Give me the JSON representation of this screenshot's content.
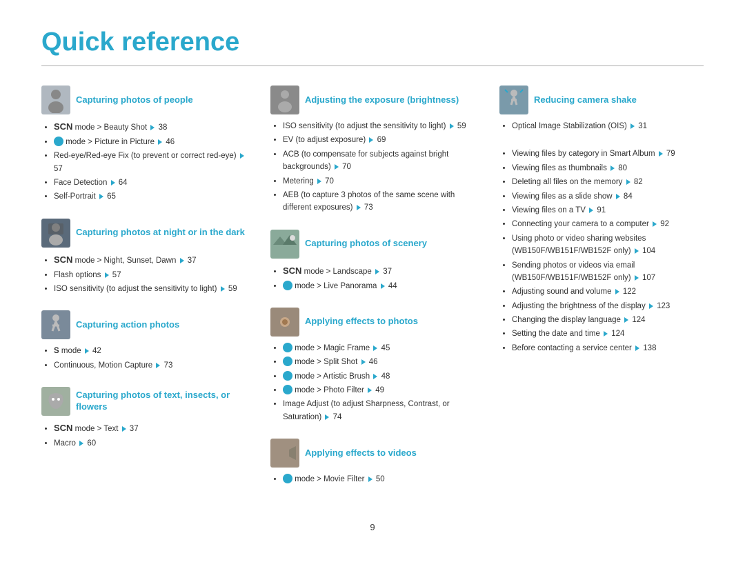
{
  "page": {
    "title": "Quick reference",
    "page_number": "9"
  },
  "columns": [
    {
      "sections": [
        {
          "id": "people",
          "title": "Capturing photos of people",
          "icon": "person-icon",
          "items": [
            "<span class='scn'>SCN</span> mode > Beauty Shot <span class='arrow'></span> 38",
            "<span class='star-icon'></span> mode > Picture in Picture <span class='arrow'></span> 46",
            "Red-eye/Red-eye Fix (to prevent or correct red-eye) <span class='arrow'></span> 57",
            "Face Detection <span class='arrow'></span> 64",
            "Self-Portrait <span class='arrow'></span> 65"
          ]
        },
        {
          "id": "night",
          "title": "Capturing photos at night or in the dark",
          "icon": "night-icon",
          "items": [
            "<span class='scn'>SCN</span> mode > Night, Sunset, Dawn <span class='arrow'></span> 37",
            "Flash options <span class='arrow'></span> 57",
            "ISO sensitivity (to adjust the sensitivity to light) <span class='arrow'></span> 59"
          ]
        },
        {
          "id": "action",
          "title": "Capturing action photos",
          "icon": "action-icon",
          "items": [
            "<b>S</b> mode <span class='arrow'></span> 42",
            "Continuous, Motion Capture <span class='arrow'></span> 73"
          ]
        },
        {
          "id": "text",
          "title": "Capturing photos of text, insects, or flowers",
          "icon": "text-icon",
          "items": [
            "<span class='scn'>SCN</span> mode > Text <span class='arrow'></span> 37",
            "Macro <span class='arrow'></span> 60"
          ]
        }
      ]
    },
    {
      "sections": [
        {
          "id": "exposure",
          "title": "Adjusting the exposure (brightness)",
          "icon": "exposure-icon",
          "items": [
            "ISO sensitivity (to adjust the sensitivity to light) <span class='arrow'></span> 59",
            "EV (to adjust exposure) <span class='arrow'></span> 69",
            "ACB (to compensate for subjects against bright backgrounds) <span class='arrow'></span> 70",
            "Metering <span class='arrow'></span> 70",
            "AEB (to capture 3 photos of the same scene with different exposures) <span class='arrow'></span> 73"
          ]
        },
        {
          "id": "scenery",
          "title": "Capturing photos of scenery",
          "icon": "scenery-icon",
          "items": [
            "<span class='scn'>SCN</span> mode > Landscape <span class='arrow'></span> 37",
            "<span class='star-icon'></span> mode > Live Panorama <span class='arrow'></span> 44"
          ]
        },
        {
          "id": "effects-photos",
          "title": "Applying effects to photos",
          "icon": "effects-photo-icon",
          "items": [
            "<span class='star-icon'></span> mode > Magic Frame <span class='arrow'></span> 45",
            "<span class='star-icon'></span> mode > Split Shot <span class='arrow'></span> 46",
            "<span class='star-icon'></span> mode > Artistic Brush <span class='arrow'></span> 48",
            "<span class='star-icon'></span> mode > Photo Filter <span class='arrow'></span> 49",
            "Image Adjust (to adjust Sharpness, Contrast, or Saturation) <span class='arrow'></span> 74"
          ]
        },
        {
          "id": "effects-videos",
          "title": "Applying effects to videos",
          "icon": "effects-video-icon",
          "items": [
            "<span class='star-icon'></span> mode > Movie Filter <span class='arrow'></span> 50"
          ]
        }
      ]
    },
    {
      "sections": [
        {
          "id": "shake",
          "title": "Reducing camera shake",
          "icon": "shake-icon",
          "items": [
            "Optical Image Stabilization (OIS) <span class='arrow'></span> 31"
          ]
        },
        {
          "id": "viewing",
          "title": "",
          "icon": null,
          "items": [
            "Viewing files by category in Smart Album <span class='arrow'></span> 79",
            "Viewing files as thumbnails <span class='arrow'></span> 80",
            "Deleting all files on the memory <span class='arrow'></span> 82",
            "Viewing files as a slide show <span class='arrow'></span> 84",
            "Viewing files on a TV <span class='arrow'></span> 91",
            "Connecting your camera to a computer <span class='arrow'></span> 92",
            "Using photo or video sharing websites (WB150F/WB151F/WB152F only) <span class='arrow'></span> 104",
            "Sending photos or videos via email (WB150F/WB151F/WB152F only) <span class='arrow'></span> 107",
            "Adjusting sound and volume <span class='arrow'></span> 122",
            "Adjusting the brightness of the display <span class='arrow'></span> 123",
            "Changing the display language <span class='arrow'></span> 124",
            "Setting the date and time <span class='arrow'></span> 124",
            "Before contacting a service center <span class='arrow'></span> 138"
          ]
        }
      ]
    }
  ]
}
